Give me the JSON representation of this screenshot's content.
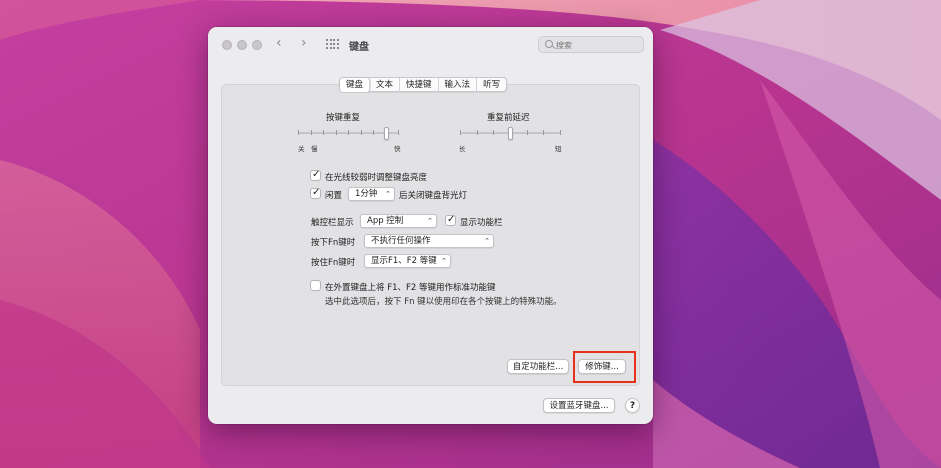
{
  "window": {
    "title": "键盘",
    "search_placeholder": "搜索"
  },
  "nav": {
    "back": "‹",
    "forward": "›"
  },
  "tabs": [
    {
      "label": "键盘",
      "active": true
    },
    {
      "label": "文本",
      "active": false
    },
    {
      "label": "快捷键",
      "active": false
    },
    {
      "label": "输入法",
      "active": false
    },
    {
      "label": "听写",
      "active": false
    }
  ],
  "key_repeat": {
    "title": "按键重复",
    "left_labels": [
      "关",
      "慢"
    ],
    "right_label": "快",
    "value_step": 7,
    "steps": 8
  },
  "delay_until_repeat": {
    "title": "重复前延迟",
    "left_label": "长",
    "right_label": "短",
    "value_step": 3,
    "steps": 6
  },
  "options": {
    "adjust_brightness": {
      "label": "在光线较弱时调整键盘亮度",
      "checked": true
    },
    "backlight_off": {
      "prefix": "闲置",
      "value": "1分钟",
      "suffix": "后关闭键盘背光灯",
      "checked": true
    }
  },
  "touchbar": {
    "label": "触控栏显示",
    "value": "App 控制",
    "show_function_row": {
      "label": "显示功能栏",
      "checked": true
    }
  },
  "press_fn": {
    "label": "按下Fn键时",
    "value": "不执行任何操作"
  },
  "hold_fn": {
    "label": "按住Fn键时",
    "value": "显示F1、F2 等键"
  },
  "external_fkeys": {
    "label": "在外置键盘上将 F1、F2 等键用作标准功能键",
    "description": "选中此选项后，按下 Fn 键以使用印在各个按键上的特殊功能。",
    "checked": false
  },
  "buttons": {
    "customize_touchbar": "自定功能栏...",
    "modifier_keys": "修饰键...",
    "setup_bluetooth": "设置蓝牙键盘...",
    "help": "?"
  },
  "colors": {
    "highlight": "#e8301c",
    "window_bg": "#ecebed",
    "panel_bg": "#e2e1e4"
  }
}
